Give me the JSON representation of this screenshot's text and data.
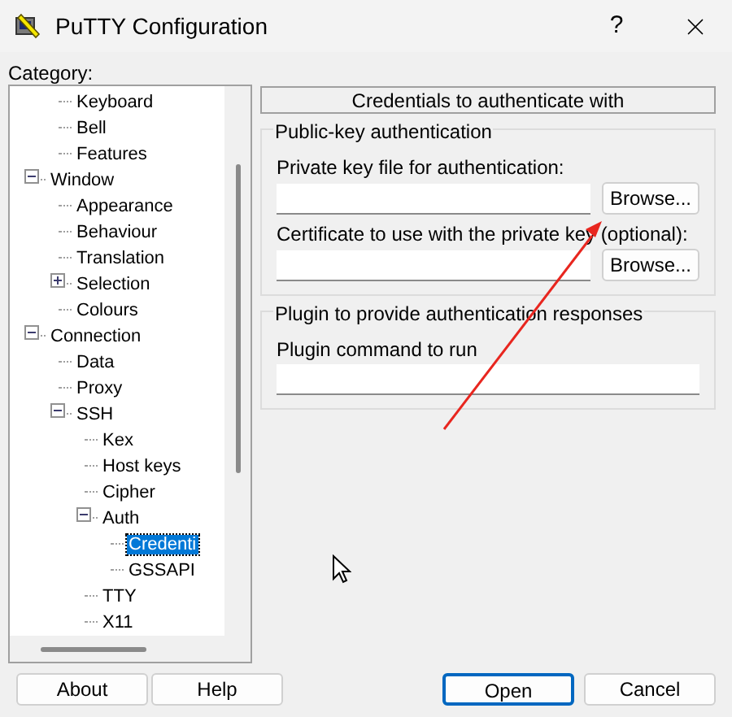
{
  "window": {
    "title": "PuTTY Configuration",
    "help": "?"
  },
  "category_label": "Category:",
  "tree": [
    {
      "children": [
        {
          "label": "Keyboard",
          "selected": false
        },
        {
          "label": "Bell",
          "selected": false
        },
        {
          "label": "Features",
          "selected": false
        }
      ]
    },
    {
      "label": "Window",
      "selected": false,
      "expanded": true,
      "children": [
        {
          "label": "Appearance",
          "selected": false
        },
        {
          "label": "Behaviour",
          "selected": false
        },
        {
          "label": "Translation",
          "selected": false
        },
        {
          "label": "Selection",
          "selected": false,
          "expanded": false
        },
        {
          "label": "Colours",
          "selected": false
        }
      ]
    },
    {
      "label": "Connection",
      "selected": false,
      "expanded": true,
      "children": [
        {
          "label": "Data",
          "selected": false
        },
        {
          "label": "Proxy",
          "selected": false
        },
        {
          "label": "SSH",
          "selected": false,
          "expanded": true,
          "children": [
            {
              "label": "Kex",
              "selected": false
            },
            {
              "label": "Host keys",
              "selected": false
            },
            {
              "label": "Cipher",
              "selected": false
            },
            {
              "label": "Auth",
              "selected": false,
              "expanded": true,
              "children": [
                {
                  "label": "Credenti",
                  "selected": true
                },
                {
                  "label": "GSSAPI",
                  "selected": false
                }
              ]
            },
            {
              "label": "TTY",
              "selected": false
            },
            {
              "label": "X11",
              "selected": false
            }
          ]
        }
      ]
    }
  ],
  "panel_title": "Credentials to authenticate with",
  "groups": [
    {
      "title": "Public-key authentication",
      "fields": [
        {
          "label": "Private key file for authentication:",
          "button": "Browse..."
        },
        {
          "label": "Certificate to use with the private key (optional):",
          "button": "Browse..."
        }
      ]
    },
    {
      "title": "Plugin to provide authentication responses",
      "fields": [
        {
          "label": "Plugin command to run"
        }
      ]
    }
  ],
  "buttons": [
    {
      "label": "About",
      "default": false
    },
    {
      "label": "Help",
      "default": false
    },
    {
      "label": "Open",
      "default": true
    },
    {
      "label": "Cancel",
      "default": false
    }
  ]
}
